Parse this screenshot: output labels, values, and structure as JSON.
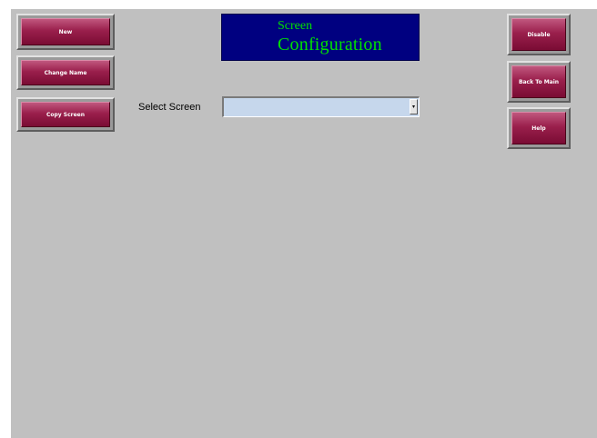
{
  "title": {
    "line1": "Screen",
    "line2": "Configuration"
  },
  "left_buttons": [
    {
      "label": "New"
    },
    {
      "label": "Change Name"
    },
    {
      "label": "Copy Screen"
    }
  ],
  "right_buttons": [
    {
      "label": "Disable"
    },
    {
      "label": "Back To Main"
    },
    {
      "label": "Help"
    }
  ],
  "select_screen": {
    "label": "Select Screen",
    "value": "",
    "arrow_icon": "chevron-down-icon"
  },
  "colors": {
    "background": "#c0c0c0",
    "button_face": "#9a1f4c",
    "title_bg": "#000080",
    "title_text": "#00e000",
    "select_bg": "#c6d7ec"
  }
}
